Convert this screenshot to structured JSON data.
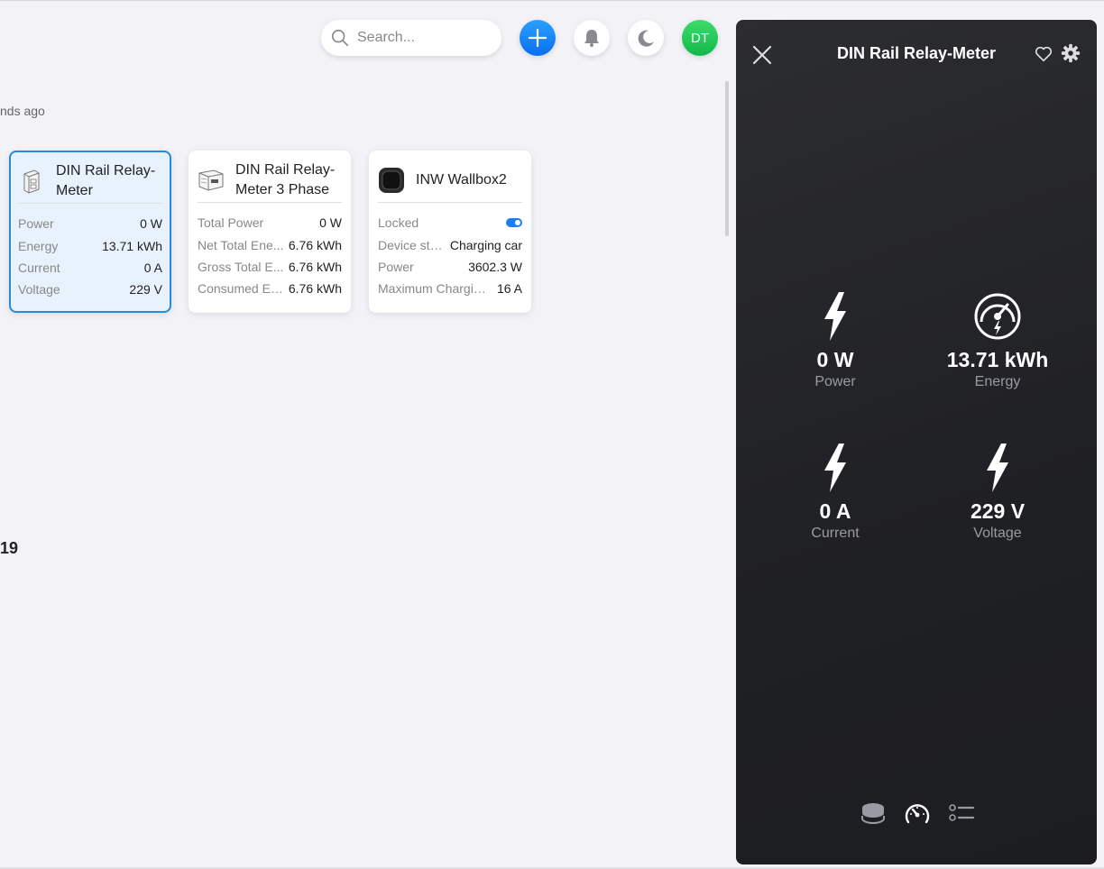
{
  "header": {
    "search": {
      "placeholder": "Search..."
    },
    "avatar_initials": "DT"
  },
  "main": {
    "ago_text": "nds ago",
    "section_number": "19",
    "cards": [
      {
        "title": "DIN Rail Relay-Meter",
        "selected": true,
        "rows": [
          {
            "label": "Power",
            "value": "0 W"
          },
          {
            "label": "Energy",
            "value": "13.71 kWh"
          },
          {
            "label": "Current",
            "value": "0 A"
          },
          {
            "label": "Voltage",
            "value": "229 V"
          }
        ]
      },
      {
        "title": "DIN Rail Relay-Meter 3 Phase",
        "selected": false,
        "rows": [
          {
            "label": "Total Power",
            "value": "0 W"
          },
          {
            "label": "Net Total Ene...",
            "value": "6.76 kWh"
          },
          {
            "label": "Gross Total E...",
            "value": "6.76 kWh"
          },
          {
            "label": "Consumed En...",
            "value": "6.76 kWh"
          }
        ]
      },
      {
        "title": "INW Wallbox2",
        "selected": false,
        "rows": [
          {
            "label": "Locked",
            "value": "",
            "toggle_on": true
          },
          {
            "label": "Device sta...",
            "value": "Charging car"
          },
          {
            "label": "Power",
            "value": "3602.3 W"
          },
          {
            "label": "Maximum Chargin...",
            "value": "16 A"
          }
        ]
      }
    ]
  },
  "panel": {
    "title": "DIN Rail Relay-Meter",
    "metrics": {
      "power": {
        "value": "0 W",
        "label": "Power",
        "icon": "lightning-icon"
      },
      "energy": {
        "value": "13.71 kWh",
        "label": "Energy",
        "icon": "energy-meter-icon"
      },
      "current": {
        "value": "0 A",
        "label": "Current",
        "icon": "lightning-icon"
      },
      "voltage": {
        "value": "229 V",
        "label": "Voltage",
        "icon": "lightning-icon"
      }
    },
    "tabs": [
      "database-icon",
      "gauge-icon",
      "list-icon"
    ]
  },
  "colors": {
    "accent": "#1a7ff0",
    "avatar": "#10b84a",
    "panel_bg": "#1f2024",
    "selected_border": "#2a8ad8"
  }
}
